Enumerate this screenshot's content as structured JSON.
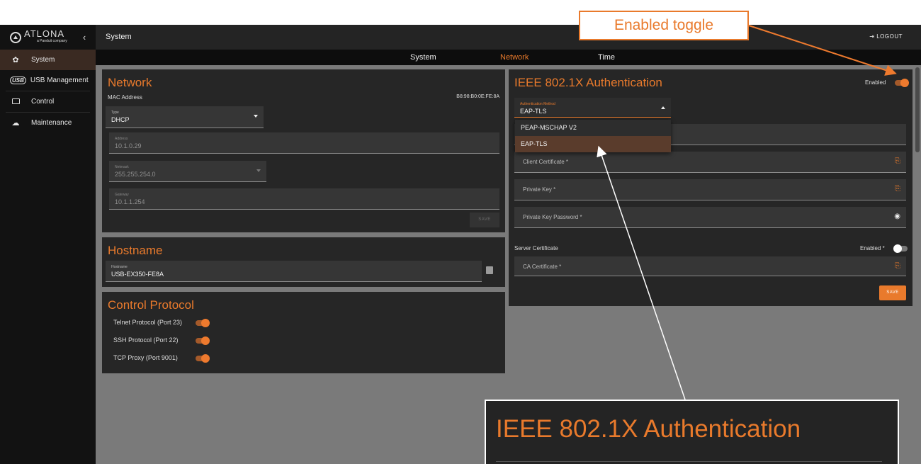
{
  "brand": {
    "name": "ATLONA",
    "tagline": "a Panduit company"
  },
  "sidebar": {
    "collapse": "‹",
    "items": [
      {
        "label": "System",
        "icon": "gear-icon",
        "active": true
      },
      {
        "label": "USB Management",
        "icon": "usb-icon",
        "badge": "USB"
      },
      {
        "label": "Control",
        "icon": "monitor-icon"
      },
      {
        "label": "Maintenance",
        "icon": "cloud-icon"
      }
    ]
  },
  "header": {
    "title": "System",
    "logout": "LOGOUT"
  },
  "tabs": [
    {
      "label": "System"
    },
    {
      "label": "Network",
      "active": true
    },
    {
      "label": "Time"
    }
  ],
  "network": {
    "title": "Network",
    "mac_label": "MAC Address",
    "mac_value": "B8:98:B0:0E:FE:8A",
    "type": {
      "label": "Type",
      "value": "DHCP"
    },
    "address": {
      "label": "Address",
      "value": "10.1.0.29"
    },
    "netmask": {
      "label": "Netmask",
      "value": "255.255.254.0"
    },
    "gateway": {
      "label": "Gateway",
      "value": "10.1.1.254"
    },
    "save": "SAVE"
  },
  "hostname": {
    "title": "Hostname",
    "label": "Hostname",
    "value": "USB-EX350-FE8A"
  },
  "control_protocol": {
    "title": "Control Protocol",
    "items": [
      {
        "label": "Telnet Protocol (Port 23)",
        "on": true
      },
      {
        "label": "SSH Protocol (Port 22)",
        "on": true
      },
      {
        "label": "TCP Proxy (Port 9001)",
        "on": true
      }
    ]
  },
  "ieee": {
    "title": "IEEE 802.1X Authentication",
    "enabled_label": "Enabled",
    "enabled": true,
    "auth_method": {
      "label": "Authentication Method",
      "value": "EAP-TLS",
      "options": [
        "PEAP-MSCHAP V2",
        "EAP-TLS"
      ],
      "selected": "EAP-TLS"
    },
    "client_cert": "Client Certificate *",
    "private_key": "Private Key *",
    "private_key_password": "Private Key Password *",
    "server_cert_label": "Server Certificate",
    "server_enabled_label": "Enabled *",
    "server_enabled": false,
    "ca_cert": "CA Certificate *",
    "save": "SAVE"
  },
  "callouts": {
    "toggle": "Enabled toggle",
    "zoom_title": "IEEE 802.1X Authentication"
  },
  "colors": {
    "accent": "#e97a2c",
    "panel": "#262626",
    "background": "#7a7a7a"
  }
}
